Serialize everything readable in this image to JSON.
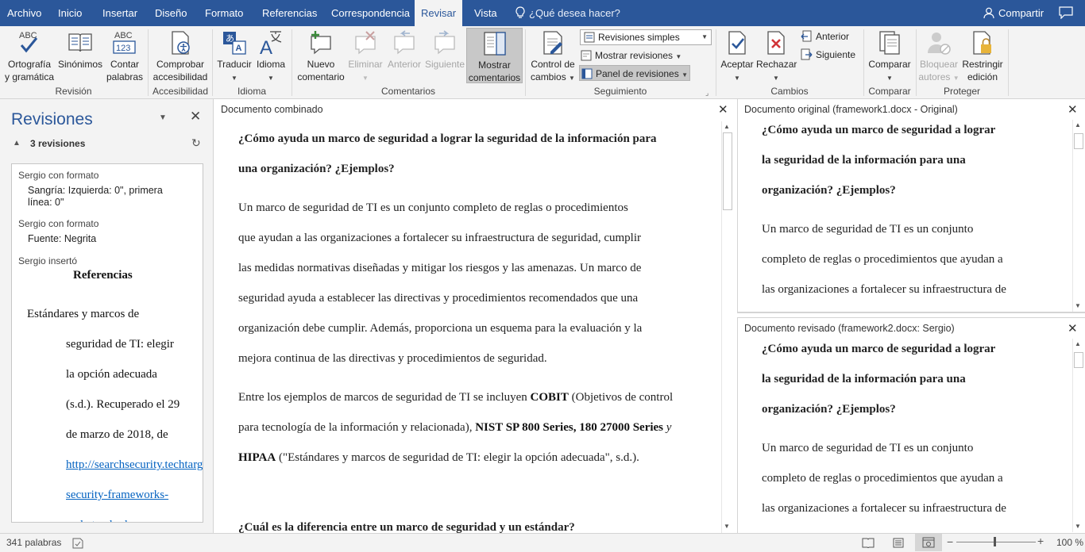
{
  "menu": {
    "tabs": [
      "Archivo",
      "Inicio",
      "Insertar",
      "Diseño",
      "Formato",
      "Referencias",
      "Correspondencia",
      "Revisar",
      "Vista"
    ],
    "active_tab": "Revisar",
    "tell_me": "¿Qué desea hacer?",
    "share": "Compartir"
  },
  "ribbon": {
    "revision": {
      "label": "Revisión",
      "spelling_1": "Ortografía",
      "spelling_2": "y gramática",
      "thesaurus": "Sinónimos",
      "wordcount_1": "Contar",
      "wordcount_2": "palabras",
      "abc": "ABC",
      "abc123": "123"
    },
    "accessibility": {
      "label": "Accesibilidad",
      "check_1": "Comprobar",
      "check_2": "accesibilidad"
    },
    "language": {
      "label": "Idioma",
      "translate": "Traducir",
      "language": "Idioma"
    },
    "comments": {
      "label": "Comentarios",
      "new_1": "Nuevo",
      "new_2": "comentario",
      "delete": "Eliminar",
      "previous": "Anterior",
      "next": "Siguiente",
      "show_1": "Mostrar",
      "show_2": "comentarios"
    },
    "tracking": {
      "label": "Seguimiento",
      "track_1": "Control de",
      "track_2": "cambios",
      "markup_select": "Revisiones simples",
      "show_markup": "Mostrar revisiones",
      "reviewing_pane": "Panel de revisiones"
    },
    "changes": {
      "label": "Cambios",
      "accept": "Aceptar",
      "reject": "Rechazar",
      "previous": "Anterior",
      "next": "Siguiente"
    },
    "compare": {
      "label": "Comparar",
      "compare": "Comparar"
    },
    "protect": {
      "label": "Proteger",
      "block_1": "Bloquear",
      "block_2": "autores",
      "restrict_1": "Restringir",
      "restrict_2": "edición"
    }
  },
  "revisions_pane": {
    "title": "Revisiones",
    "count": "3 revisiones",
    "items": [
      {
        "author": "Sergio con formato",
        "detail_1": "Sangría: Izquierda: 0\", primera",
        "detail_2": "línea: 0\""
      },
      {
        "author": "Sergio con formato",
        "detail_1": "Fuente: Negrita"
      },
      {
        "author": "Sergio insertó"
      }
    ],
    "inserted": {
      "heading": "Referencias",
      "lines": [
        "Estándares y marcos de",
        "seguridad de TI: elegir",
        "la opción adecuada",
        "(s.d.). Recuperado el 29",
        "de marzo de 2018, de"
      ],
      "link_1": "http://searchsecurity.techtarget.com/",
      "link_2": "security-frameworks-",
      "link_3": "and-standards"
    }
  },
  "combined": {
    "header": "Documento combinado",
    "title_1": "¿Cómo ayuda un marco de seguridad a lograr la seguridad de la información para",
    "title_2": "una organización? ¿Ejemplos?",
    "p1": [
      "Un marco de seguridad de TI es un conjunto completo de reglas o procedimientos",
      "que ayudan a las organizaciones a fortalecer su infraestructura de seguridad, cumplir",
      "las medidas normativas diseñadas y mitigar los riesgos y las amenazas. Un marco de",
      "seguridad ayuda a establecer las directivas y procedimientos recomendados que una",
      "organización debe cumplir. Además, proporciona un esquema para la evaluación y la",
      "mejora continua de las directivas y procedimientos de seguridad."
    ],
    "p2_l1_a": "Entre los ejemplos de marcos de seguridad de TI se incluyen ",
    "p2_l1_b": "COBIT",
    "p2_l1_c": " (Objetivos de control",
    "p2_l2_a": "para tecnología de la información y relacionada), ",
    "p2_l2_b": "NIST SP 800 Series, 180 27000 Series",
    "p2_l2_c": " y",
    "p2_l3_a": "HIPAA",
    "p2_l3_b": " (\"Estándares y marcos de seguridad de TI: elegir la opción adecuada\", s.d.).",
    "title2": "¿Cuál es la diferencia entre un marco de seguridad y un estándar?"
  },
  "original": {
    "header": "Documento original (framework1.docx - Original)",
    "title": [
      "¿Cómo ayuda un marco de seguridad a lograr",
      "la seguridad de la información para una",
      "organización? ¿Ejemplos?"
    ],
    "lines": [
      "Un marco de seguridad de TI es un conjunto",
      "completo de reglas o procedimientos que ayudan a",
      "las organizaciones a fortalecer su infraestructura de"
    ]
  },
  "revised": {
    "header": "Documento revisado (framework2.docx: Sergio)",
    "title": [
      "¿Cómo ayuda un marco de seguridad a lograr",
      "la seguridad de la información para una",
      "organización? ¿Ejemplos?"
    ],
    "lines": [
      "Un marco de seguridad de TI es un conjunto",
      "completo de reglas o procedimientos que ayudan a",
      "las organizaciones a fortalecer su infraestructura de"
    ]
  },
  "status": {
    "words": "341 palabras",
    "zoom": "100 %"
  },
  "colors": {
    "brand": "#2b579a",
    "link": "#0563c1"
  }
}
